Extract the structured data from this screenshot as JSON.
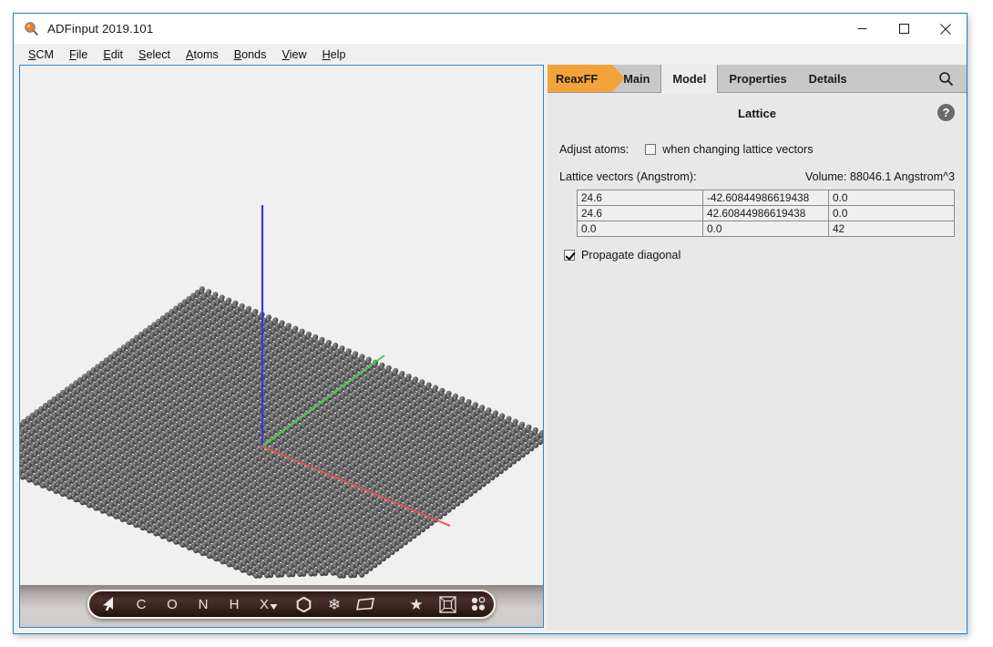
{
  "window": {
    "title": "ADFinput 2019.101",
    "app_icon": "magnifier-icon",
    "controls": {
      "minimize": "minimize-icon",
      "maximize": "maximize-icon",
      "close": "close-icon"
    }
  },
  "menubar": {
    "items": [
      {
        "label": "SCM",
        "mnemonic": "S"
      },
      {
        "label": "File",
        "mnemonic": "F"
      },
      {
        "label": "Edit",
        "mnemonic": "E"
      },
      {
        "label": "Select",
        "mnemonic": "S"
      },
      {
        "label": "Atoms",
        "mnemonic": "A"
      },
      {
        "label": "Bonds",
        "mnemonic": "B"
      },
      {
        "label": "View",
        "mnemonic": "V"
      },
      {
        "label": "Help",
        "mnemonic": "H"
      }
    ]
  },
  "viewport": {
    "structure": "graphene-sheet",
    "background": "#f0f0f0",
    "atom_color": "#4a4a4a",
    "axes": [
      {
        "name": "x-axis",
        "color": "#e8545a"
      },
      {
        "name": "y-axis",
        "color": "#45d145"
      },
      {
        "name": "z-axis",
        "color": "#3a36e0"
      }
    ]
  },
  "toolbar": {
    "items": [
      {
        "name": "select-cursor-tool",
        "glyph": "➤"
      },
      {
        "name": "carbon-tool",
        "glyph": "C"
      },
      {
        "name": "oxygen-tool",
        "glyph": "O"
      },
      {
        "name": "nitrogen-tool",
        "glyph": "N"
      },
      {
        "name": "hydrogen-tool",
        "glyph": "H"
      },
      {
        "name": "element-picker-tool",
        "glyph": "X"
      },
      {
        "name": "ring-tool",
        "glyph": "⬢"
      },
      {
        "name": "crystal-tool",
        "glyph": "❄"
      },
      {
        "name": "plane-tool",
        "glyph": "▱"
      },
      {
        "name": "favorites-tool",
        "glyph": "★"
      },
      {
        "name": "unit-cell-tool",
        "glyph": "⧉"
      },
      {
        "name": "multi-view-tool",
        "glyph": "⁙"
      }
    ]
  },
  "panel": {
    "tabs": [
      {
        "label": "ReaxFF",
        "name": "tab-reaxff",
        "style": "brand",
        "active": false
      },
      {
        "label": "Main",
        "name": "tab-main",
        "style": "normal",
        "active": false
      },
      {
        "label": "Model",
        "name": "tab-model",
        "style": "normal",
        "active": true
      },
      {
        "label": "Properties",
        "name": "tab-properties",
        "style": "normal",
        "active": false
      },
      {
        "label": "Details",
        "name": "tab-details",
        "style": "normal",
        "active": false
      }
    ],
    "search_icon": "search-icon",
    "section_title": "Lattice",
    "help_glyph": "?",
    "adjust_atoms": {
      "label": "Adjust atoms:",
      "checkbox_label": "when changing lattice vectors",
      "checked": false
    },
    "lattice_vectors_label": "Lattice vectors (Angstrom):",
    "volume_label": "Volume: 88046.1 Angstrom^3",
    "lattice_rows": [
      [
        "24.6",
        "-42.60844986619438",
        "0.0"
      ],
      [
        "24.6",
        "42.60844986619438",
        "0.0"
      ],
      [
        "0.0",
        "0.0",
        "42"
      ]
    ],
    "propagate_diagonal": {
      "label": "Propagate diagonal",
      "checked": true
    }
  },
  "colors": {
    "brand_orange": "#f2a43a",
    "window_border": "#1d7fcb",
    "panel_bg": "#e8e8e8",
    "tabbar_bg": "#c8c8c8"
  }
}
